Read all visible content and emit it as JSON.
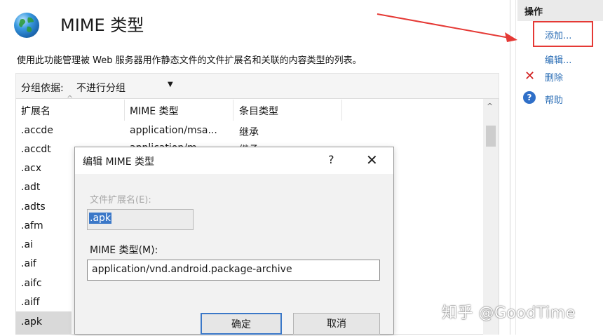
{
  "header": {
    "title": "MIME 类型",
    "description": "使用此功能管理被 Web 服务器用作静态文件的文件扩展名和关联的内容类型的列表。"
  },
  "group_bar": {
    "label": "分组依据:",
    "value": "不进行分组"
  },
  "list": {
    "columns": [
      "扩展名",
      "MIME 类型",
      "条目类型"
    ],
    "rows": [
      {
        "ext": ".accde",
        "mime": "application/msa...",
        "entry": "继承"
      },
      {
        "ext": ".accdt",
        "mime": "application/m...",
        "entry": "继承"
      },
      {
        "ext": ".acx",
        "mime": "",
        "entry": ""
      },
      {
        "ext": ".adt",
        "mime": "",
        "entry": ""
      },
      {
        "ext": ".adts",
        "mime": "",
        "entry": ""
      },
      {
        "ext": ".afm",
        "mime": "",
        "entry": ""
      },
      {
        "ext": ".ai",
        "mime": "",
        "entry": ""
      },
      {
        "ext": ".aif",
        "mime": "",
        "entry": ""
      },
      {
        "ext": ".aifc",
        "mime": "",
        "entry": ""
      },
      {
        "ext": ".aiff",
        "mime": "",
        "entry": ""
      },
      {
        "ext": ".apk",
        "mime": "",
        "entry": ""
      }
    ],
    "selected_row": ".apk"
  },
  "actions": {
    "title": "操作",
    "items": [
      "添加...",
      "编辑...",
      "删除",
      "帮助"
    ]
  },
  "dialog": {
    "title": "编辑 MIME 类型",
    "help": "?",
    "close": "✕",
    "ext_label": "文件扩展名(E):",
    "ext_value": ".apk",
    "mime_label": "MIME 类型(M):",
    "mime_value": "application/vnd.android.package-archive",
    "ok": "确定",
    "cancel": "取消"
  },
  "watermark": "知乎 @GoodTime",
  "colors": {
    "accent": "#3b78c8",
    "link": "#2a6db5",
    "highlight_box": "#e53935",
    "delete_icon": "#d11f1f"
  }
}
